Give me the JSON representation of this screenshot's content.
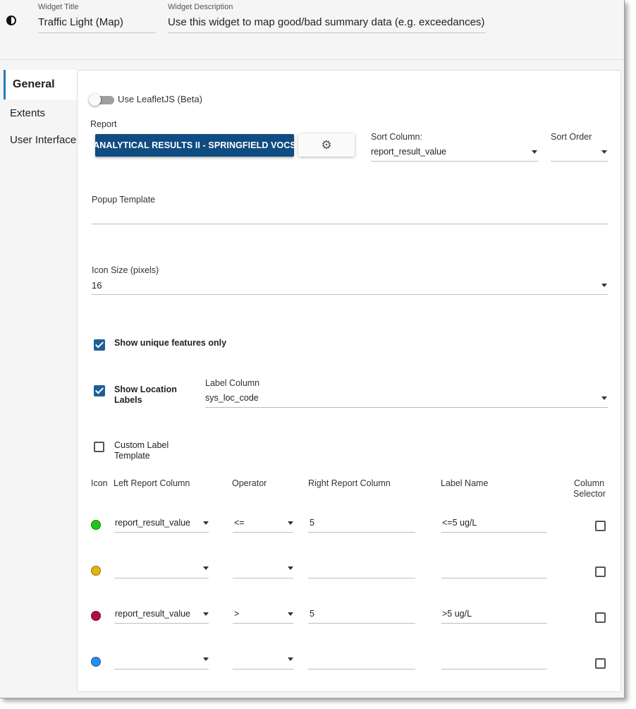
{
  "header": {
    "title_label": "Widget Title",
    "title_value": "Traffic Light (Map)",
    "description_label": "Widget Description",
    "description_value": "Use this widget to map good/bad summary data (e.g. exceedances) fr"
  },
  "tabs": [
    {
      "label": "General",
      "active": true
    },
    {
      "label": "Extents",
      "active": false
    },
    {
      "label": "User Interface",
      "active": false
    }
  ],
  "general": {
    "leaflet_toggle_label": "Use LeafletJS (Beta)",
    "leaflet_enabled": false,
    "report_label": "Report",
    "report_button": "ANALYTICAL RESULTS II - SPRINGFIELD VOCS",
    "settings_icon": "gear-icon",
    "sort_column_label": "Sort Column:",
    "sort_column_value": "report_result_value",
    "sort_order_label": "Sort Order",
    "sort_order_value": "",
    "popup_template_label": "Popup Template",
    "popup_template_value": "",
    "icon_size_label": "Icon Size (pixels)",
    "icon_size_value": "16",
    "show_unique_label": "Show unique features only",
    "show_unique_checked": true,
    "show_location_label_1": "Show Location",
    "show_location_label_2": "Labels",
    "show_location_checked": true,
    "label_column_label": "Label Column",
    "label_column_value": "sys_loc_code",
    "custom_label_1": "Custom Label",
    "custom_label_2": "Template",
    "custom_label_checked": false
  },
  "rules_table": {
    "headers": {
      "icon": "Icon",
      "left": "Left Report Column",
      "operator": "Operator",
      "right": "Right Report Column",
      "label": "Label Name",
      "selector_1": "Column",
      "selector_2": "Selector"
    },
    "rows": [
      {
        "color": "#22c41a",
        "left": "report_result_value",
        "operator": "<=",
        "right": "5",
        "label": "<=5 ug/L",
        "selector": false
      },
      {
        "color": "#e2b40c",
        "left": "",
        "operator": "",
        "right": "",
        "label": "",
        "selector": false
      },
      {
        "color": "#b0103c",
        "left": "report_result_value",
        "operator": ">",
        "right": "5",
        "label": ">5 ug/L",
        "selector": false
      },
      {
        "color": "#2a8ee8",
        "left": "",
        "operator": "",
        "right": "",
        "label": "",
        "selector": false
      }
    ]
  }
}
